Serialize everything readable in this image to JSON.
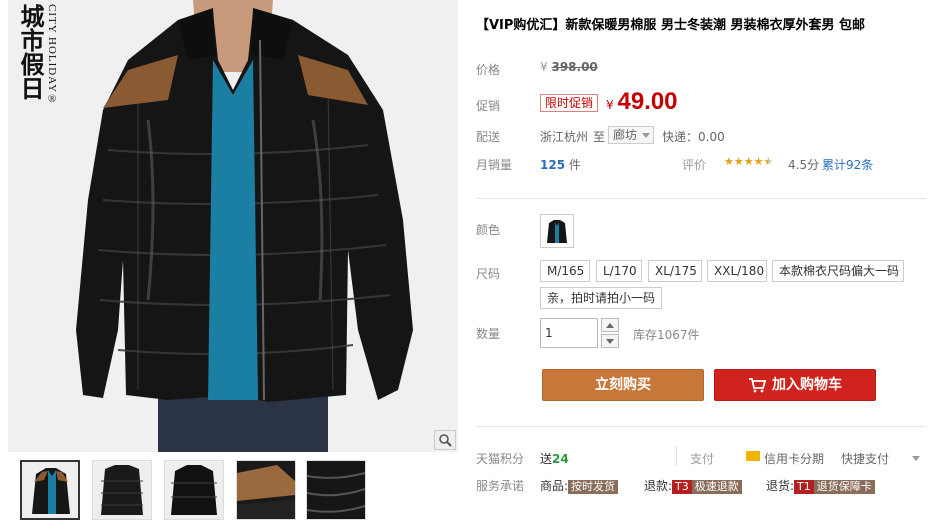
{
  "gallery": {
    "brand_cn": "城市假日",
    "brand_en": "CITY HOLIDAY®"
  },
  "product": {
    "title": "【VIP购优汇】新款保暖男棉服 男士冬装潮 男装棉衣厚外套男 包邮"
  },
  "price": {
    "label": "价格",
    "currency": "¥",
    "original": "398.00"
  },
  "promo": {
    "label": "促销",
    "badge": "限时促销",
    "currency": "¥",
    "price": "49.00"
  },
  "shipping": {
    "label": "配送",
    "from": "浙江杭州",
    "to_word": "至",
    "destination": "廊坊",
    "fee": "快递：0.00"
  },
  "sales": {
    "label": "月销量",
    "count": "125",
    "unit": "件"
  },
  "rating": {
    "label": "评价",
    "stars": 4.5,
    "score": "4.5分",
    "total": "累计92条"
  },
  "color": {
    "label": "颜色"
  },
  "size": {
    "label": "尺码",
    "options": [
      "M/165",
      "L/170",
      "XL/175",
      "XXL/180",
      "本款棉衣尺码偏大一码",
      "亲，拍时请拍小一码"
    ]
  },
  "quantity": {
    "label": "数量",
    "value": "1",
    "stock": "库存1067件"
  },
  "actions": {
    "buy": "立刻购买",
    "cart": "加入购物车"
  },
  "points": {
    "label": "天猫积分",
    "give": "送",
    "amount": "24",
    "pay_label": "支付",
    "credit": "信用卡分期",
    "quick": "快捷支付"
  },
  "service": {
    "label": "服务承诺",
    "goods": "商品:",
    "goods_tag": "按时发货",
    "refund": "退款:",
    "refund_code": "T3",
    "refund_tag": "极速退款",
    "return": "退货:",
    "return_code": "T1",
    "return_tag": "退货保障卡"
  },
  "colors": {
    "promo_red": "#c40000",
    "buy_orange": "#c8773a",
    "cart_red": "#d0231e",
    "star_gold": "#e3a21a"
  }
}
